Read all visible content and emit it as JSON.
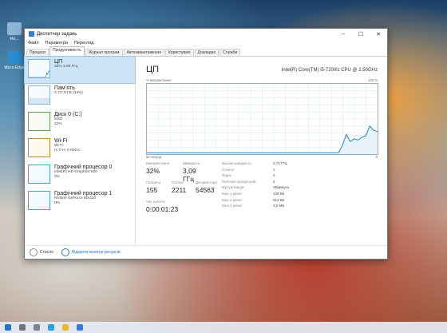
{
  "desktop": {
    "icons": [
      {
        "label": "Re..."
      },
      {
        "label": "Micro\nEdge"
      }
    ]
  },
  "window": {
    "title": "Диспетчер задань",
    "controls": [
      "–",
      "☐",
      "✕"
    ],
    "menu": [
      "Файл",
      "Параметри",
      "Перегляд"
    ],
    "tabs": [
      "Процеси",
      "Продуктивність",
      "Журнал програм",
      "Автозавантаження",
      "Користувачі",
      "Докладно",
      "Служби"
    ],
    "active_tab": 1
  },
  "resources": [
    {
      "name": "ЦП",
      "sub1": "32%  3,09 ГГц",
      "sub2": "",
      "kind": "cpu"
    },
    {
      "name": "Пам’ять",
      "sub1": "2,7/7,9 ГБ (34%)",
      "sub2": "",
      "kind": "mem"
    },
    {
      "name": "Диск 0 (C:)",
      "sub1": "SSD",
      "sub2": "12%",
      "kind": "disk"
    },
    {
      "name": "Wi-Fi",
      "sub1": "Wi-Fi",
      "sub2": "Н: 0 Н: 0 Кбіт/с",
      "kind": "net"
    },
    {
      "name": "Графічний процесор 0",
      "sub1": "Intel(R) HD Graphics 620",
      "sub2": "0%",
      "kind": "gpu"
    },
    {
      "name": "Графічний процесор 1",
      "sub1": "NVIDIA GeForce MX110",
      "sub2": "0%",
      "kind": "gpu"
    }
  ],
  "detail": {
    "title": "ЦП",
    "model": "Intel(R) Core(TM) i5-7200U CPU @ 2.50GHz",
    "graph_top_left": "% використання",
    "graph_top_right": "100 %",
    "graph_bottom_left": "60 секунд",
    "graph_bottom_right": "0",
    "usage_label": "Використання",
    "usage_value": "32%",
    "speed_label": "Швидкість",
    "speed_value": "3,09 ГГц",
    "proc_label": "Процеси",
    "proc_value": "155",
    "threads_label": "Потоки",
    "threads_value": "2211",
    "handles_label": "Дескриптори",
    "handles_value": "54563",
    "uptime_label": "Час роботи",
    "uptime_value": "0:00:01:23",
    "info": [
      {
        "k": "Базова швидкість:",
        "v": "2,71 ГГц"
      },
      {
        "k": "Сокети:",
        "v": "1"
      },
      {
        "k": "Ядра:",
        "v": "2"
      },
      {
        "k": "Логічних процесорів:",
        "v": "4"
      },
      {
        "k": "Віртуалізація:",
        "v": "Увімкнуто"
      },
      {
        "k": "Кеш 1 рівня:",
        "v": "128 КБ"
      },
      {
        "k": "Кеш 2 рівня:",
        "v": "512 КБ"
      },
      {
        "k": "Кеш 3 рівня:",
        "v": "3,0 МБ"
      }
    ]
  },
  "footer": {
    "less": "Стисло",
    "monitor": "Відкрити монітор ресурсів"
  },
  "cpu_history": [
    2,
    2,
    2,
    2,
    2,
    2,
    2,
    2,
    2,
    2,
    2,
    2,
    2,
    2,
    2,
    2,
    2,
    2,
    2,
    2,
    2,
    2,
    2,
    2,
    2,
    2,
    2,
    2,
    2,
    2,
    2,
    2,
    2,
    2,
    2,
    2,
    2,
    2,
    2,
    2,
    2,
    2,
    2,
    2,
    2,
    2,
    2,
    2,
    2,
    2,
    12,
    28,
    18,
    22,
    20,
    24,
    26,
    40,
    34,
    32
  ],
  "colors": {
    "accent": "#117dbb",
    "graph_fill": "#e6f1f9"
  }
}
